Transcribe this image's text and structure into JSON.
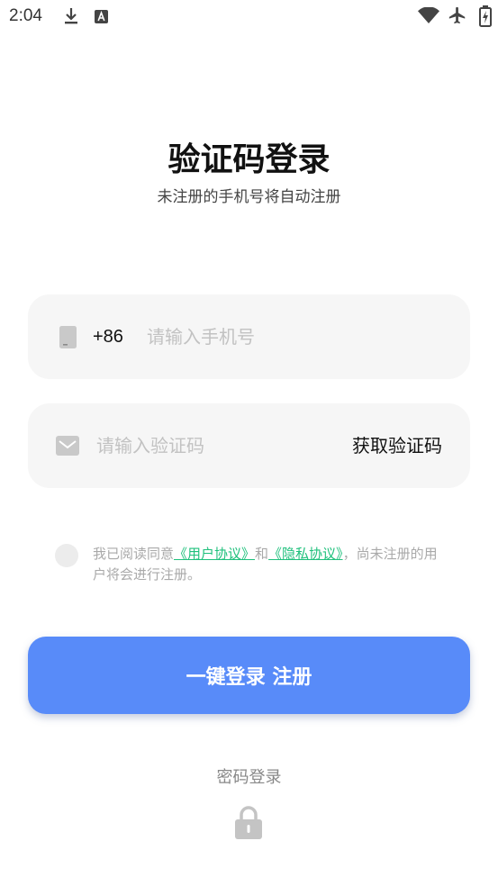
{
  "status_bar": {
    "time": "2:04",
    "icons": {
      "left": [
        "download-icon",
        "a-square-icon"
      ],
      "right": [
        "wifi-icon",
        "airplane-icon",
        "battery-charging-icon"
      ]
    }
  },
  "header": {
    "title": "验证码登录",
    "subtitle": "未注册的手机号将自动注册"
  },
  "phone_field": {
    "icon": "phone-icon",
    "country_code": "+86",
    "placeholder": "请输入手机号",
    "value": ""
  },
  "code_field": {
    "icon": "mail-icon",
    "placeholder": "请输入验证码",
    "value": "",
    "get_code_label": "获取验证码"
  },
  "agreement": {
    "checked": false,
    "prefix": "我已阅读同意",
    "user_agreement": "《用户协议》",
    "connector": "和",
    "privacy_policy": "《隐私协议》",
    "suffix": "，尚未注册的用户将会进行注册。"
  },
  "login_button": {
    "label": "一键登录 注册"
  },
  "password_login": {
    "label": "密码登录",
    "icon": "lock-icon"
  },
  "theme": {
    "accent": "#588bf9",
    "link": "#1fc07c",
    "field_background": "#f6f6f6",
    "muted_text": "#a9a9a9",
    "icon_gray": "#c9c9c9"
  }
}
